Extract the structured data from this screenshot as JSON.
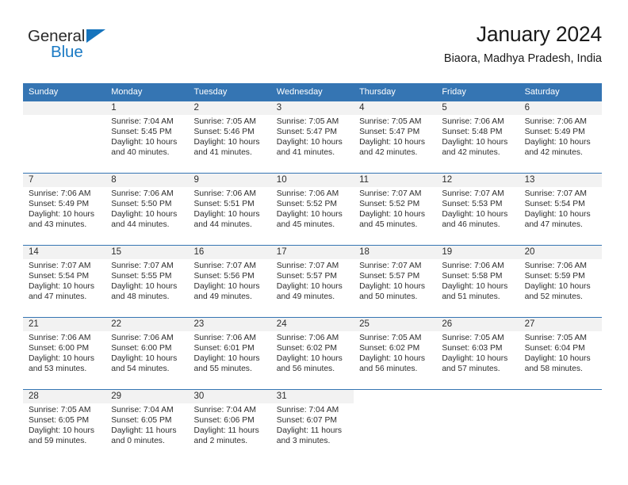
{
  "brand": {
    "name_part1": "General",
    "name_part2": "Blue",
    "logo_icon": "triangle-logo-icon",
    "accent_color": "#1a7ac4"
  },
  "header": {
    "title": "January 2024",
    "subtitle": "Biaora, Madhya Pradesh, India"
  },
  "calendar": {
    "header_bg_color": "#3575b3",
    "daynum_bg_color": "#f2f2f2",
    "weekday_headers": [
      "Sunday",
      "Monday",
      "Tuesday",
      "Wednesday",
      "Thursday",
      "Friday",
      "Saturday"
    ],
    "weeks": [
      [
        {
          "day": "",
          "blank": true
        },
        {
          "day": "1",
          "sunrise": "Sunrise: 7:04 AM",
          "sunset": "Sunset: 5:45 PM",
          "daylight_line1": "Daylight: 10 hours",
          "daylight_line2": "and 40 minutes."
        },
        {
          "day": "2",
          "sunrise": "Sunrise: 7:05 AM",
          "sunset": "Sunset: 5:46 PM",
          "daylight_line1": "Daylight: 10 hours",
          "daylight_line2": "and 41 minutes."
        },
        {
          "day": "3",
          "sunrise": "Sunrise: 7:05 AM",
          "sunset": "Sunset: 5:47 PM",
          "daylight_line1": "Daylight: 10 hours",
          "daylight_line2": "and 41 minutes."
        },
        {
          "day": "4",
          "sunrise": "Sunrise: 7:05 AM",
          "sunset": "Sunset: 5:47 PM",
          "daylight_line1": "Daylight: 10 hours",
          "daylight_line2": "and 42 minutes."
        },
        {
          "day": "5",
          "sunrise": "Sunrise: 7:06 AM",
          "sunset": "Sunset: 5:48 PM",
          "daylight_line1": "Daylight: 10 hours",
          "daylight_line2": "and 42 minutes."
        },
        {
          "day": "6",
          "sunrise": "Sunrise: 7:06 AM",
          "sunset": "Sunset: 5:49 PM",
          "daylight_line1": "Daylight: 10 hours",
          "daylight_line2": "and 42 minutes."
        }
      ],
      [
        {
          "day": "7",
          "sunrise": "Sunrise: 7:06 AM",
          "sunset": "Sunset: 5:49 PM",
          "daylight_line1": "Daylight: 10 hours",
          "daylight_line2": "and 43 minutes."
        },
        {
          "day": "8",
          "sunrise": "Sunrise: 7:06 AM",
          "sunset": "Sunset: 5:50 PM",
          "daylight_line1": "Daylight: 10 hours",
          "daylight_line2": "and 44 minutes."
        },
        {
          "day": "9",
          "sunrise": "Sunrise: 7:06 AM",
          "sunset": "Sunset: 5:51 PM",
          "daylight_line1": "Daylight: 10 hours",
          "daylight_line2": "and 44 minutes."
        },
        {
          "day": "10",
          "sunrise": "Sunrise: 7:06 AM",
          "sunset": "Sunset: 5:52 PM",
          "daylight_line1": "Daylight: 10 hours",
          "daylight_line2": "and 45 minutes."
        },
        {
          "day": "11",
          "sunrise": "Sunrise: 7:07 AM",
          "sunset": "Sunset: 5:52 PM",
          "daylight_line1": "Daylight: 10 hours",
          "daylight_line2": "and 45 minutes."
        },
        {
          "day": "12",
          "sunrise": "Sunrise: 7:07 AM",
          "sunset": "Sunset: 5:53 PM",
          "daylight_line1": "Daylight: 10 hours",
          "daylight_line2": "and 46 minutes."
        },
        {
          "day": "13",
          "sunrise": "Sunrise: 7:07 AM",
          "sunset": "Sunset: 5:54 PM",
          "daylight_line1": "Daylight: 10 hours",
          "daylight_line2": "and 47 minutes."
        }
      ],
      [
        {
          "day": "14",
          "sunrise": "Sunrise: 7:07 AM",
          "sunset": "Sunset: 5:54 PM",
          "daylight_line1": "Daylight: 10 hours",
          "daylight_line2": "and 47 minutes."
        },
        {
          "day": "15",
          "sunrise": "Sunrise: 7:07 AM",
          "sunset": "Sunset: 5:55 PM",
          "daylight_line1": "Daylight: 10 hours",
          "daylight_line2": "and 48 minutes."
        },
        {
          "day": "16",
          "sunrise": "Sunrise: 7:07 AM",
          "sunset": "Sunset: 5:56 PM",
          "daylight_line1": "Daylight: 10 hours",
          "daylight_line2": "and 49 minutes."
        },
        {
          "day": "17",
          "sunrise": "Sunrise: 7:07 AM",
          "sunset": "Sunset: 5:57 PM",
          "daylight_line1": "Daylight: 10 hours",
          "daylight_line2": "and 49 minutes."
        },
        {
          "day": "18",
          "sunrise": "Sunrise: 7:07 AM",
          "sunset": "Sunset: 5:57 PM",
          "daylight_line1": "Daylight: 10 hours",
          "daylight_line2": "and 50 minutes."
        },
        {
          "day": "19",
          "sunrise": "Sunrise: 7:06 AM",
          "sunset": "Sunset: 5:58 PM",
          "daylight_line1": "Daylight: 10 hours",
          "daylight_line2": "and 51 minutes."
        },
        {
          "day": "20",
          "sunrise": "Sunrise: 7:06 AM",
          "sunset": "Sunset: 5:59 PM",
          "daylight_line1": "Daylight: 10 hours",
          "daylight_line2": "and 52 minutes."
        }
      ],
      [
        {
          "day": "21",
          "sunrise": "Sunrise: 7:06 AM",
          "sunset": "Sunset: 6:00 PM",
          "daylight_line1": "Daylight: 10 hours",
          "daylight_line2": "and 53 minutes."
        },
        {
          "day": "22",
          "sunrise": "Sunrise: 7:06 AM",
          "sunset": "Sunset: 6:00 PM",
          "daylight_line1": "Daylight: 10 hours",
          "daylight_line2": "and 54 minutes."
        },
        {
          "day": "23",
          "sunrise": "Sunrise: 7:06 AM",
          "sunset": "Sunset: 6:01 PM",
          "daylight_line1": "Daylight: 10 hours",
          "daylight_line2": "and 55 minutes."
        },
        {
          "day": "24",
          "sunrise": "Sunrise: 7:06 AM",
          "sunset": "Sunset: 6:02 PM",
          "daylight_line1": "Daylight: 10 hours",
          "daylight_line2": "and 56 minutes."
        },
        {
          "day": "25",
          "sunrise": "Sunrise: 7:05 AM",
          "sunset": "Sunset: 6:02 PM",
          "daylight_line1": "Daylight: 10 hours",
          "daylight_line2": "and 56 minutes."
        },
        {
          "day": "26",
          "sunrise": "Sunrise: 7:05 AM",
          "sunset": "Sunset: 6:03 PM",
          "daylight_line1": "Daylight: 10 hours",
          "daylight_line2": "and 57 minutes."
        },
        {
          "day": "27",
          "sunrise": "Sunrise: 7:05 AM",
          "sunset": "Sunset: 6:04 PM",
          "daylight_line1": "Daylight: 10 hours",
          "daylight_line2": "and 58 minutes."
        }
      ],
      [
        {
          "day": "28",
          "sunrise": "Sunrise: 7:05 AM",
          "sunset": "Sunset: 6:05 PM",
          "daylight_line1": "Daylight: 10 hours",
          "daylight_line2": "and 59 minutes."
        },
        {
          "day": "29",
          "sunrise": "Sunrise: 7:04 AM",
          "sunset": "Sunset: 6:05 PM",
          "daylight_line1": "Daylight: 11 hours",
          "daylight_line2": "and 0 minutes."
        },
        {
          "day": "30",
          "sunrise": "Sunrise: 7:04 AM",
          "sunset": "Sunset: 6:06 PM",
          "daylight_line1": "Daylight: 11 hours",
          "daylight_line2": "and 2 minutes."
        },
        {
          "day": "31",
          "sunrise": "Sunrise: 7:04 AM",
          "sunset": "Sunset: 6:07 PM",
          "daylight_line1": "Daylight: 11 hours",
          "daylight_line2": "and 3 minutes."
        },
        {
          "day": "",
          "trailing": true
        },
        {
          "day": "",
          "trailing": true
        },
        {
          "day": "",
          "trailing": true
        }
      ]
    ]
  }
}
